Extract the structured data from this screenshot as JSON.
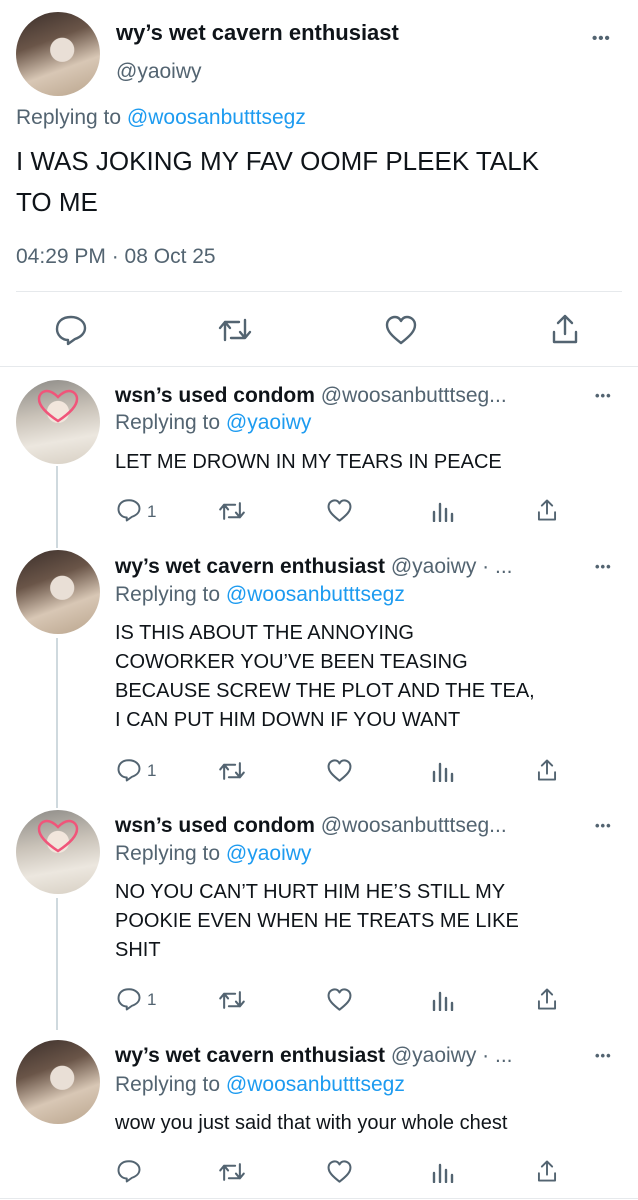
{
  "main_tweet": {
    "display_name": "wy’s wet cavern enthusiast",
    "handle": "@yaoiwy",
    "more": "•••",
    "replying_prefix": "Replying to ",
    "replying_to": "@woosanbutttsegz",
    "text_line1": "I WAS JOKING MY FAV OOMF PLEEK TALK",
    "text_line2": "TO ME",
    "timestamp": "04:29 PM · 08 Oct 25"
  },
  "replies": [
    {
      "display_name": "wsn’s used condom",
      "handle_suffix": "@woosanbutttseg...",
      "replying_prefix": "Replying to ",
      "replying_to": "@yaoiwy",
      "lines": [
        "LET ME DROWN IN MY TEARS IN PEACE"
      ],
      "reply_count": "1"
    },
    {
      "display_name": "wy’s wet cavern enthusiast",
      "handle_suffix": "@yaoiwy · ...",
      "replying_prefix": "Replying to ",
      "replying_to": "@woosanbutttsegz",
      "lines": [
        "IS THIS ABOUT THE ANNOYING",
        "COWORKER YOU’VE BEEN TEASING",
        "BECAUSE SCREW THE PLOT AND THE TEA,",
        "I CAN PUT HIM DOWN IF YOU WANT"
      ],
      "reply_count": "1"
    },
    {
      "display_name": "wsn’s used condom",
      "handle_suffix": "@woosanbutttseg...",
      "replying_prefix": "Replying to ",
      "replying_to": "@yaoiwy",
      "lines": [
        "NO YOU CAN’T HURT HIM HE’S STILL MY",
        "POOKIE EVEN WHEN HE TREATS ME LIKE",
        "SHIT"
      ],
      "reply_count": "1"
    },
    {
      "display_name": "wy’s wet cavern enthusiast",
      "handle_suffix": "@yaoiwy · ...",
      "replying_prefix": "Replying to ",
      "replying_to": "@woosanbutttsegz",
      "lines": [
        "wow you just said that with your whole chest"
      ],
      "reply_count": ""
    }
  ],
  "more_label": "•••",
  "icons": [
    "reply-icon",
    "retweet-icon",
    "like-icon",
    "views-icon",
    "share-icon"
  ],
  "colors": {
    "link": "#1d9bf0",
    "muted": "#536471",
    "text": "#0f1419",
    "heart": "#f0557a"
  }
}
